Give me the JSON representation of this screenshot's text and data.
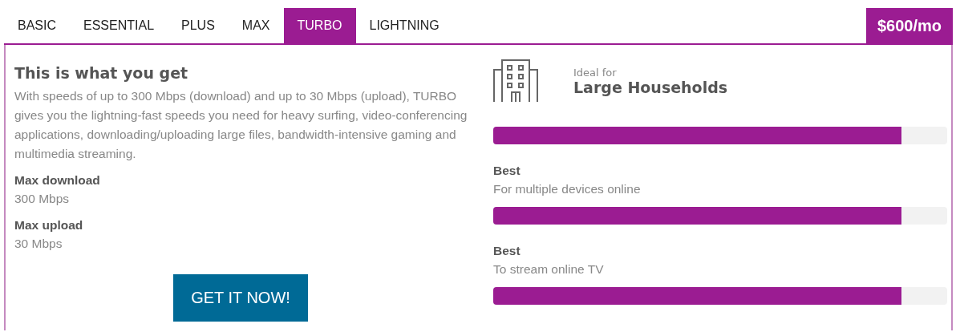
{
  "tabs": [
    {
      "label": "BASIC",
      "selected": false
    },
    {
      "label": "ESSENTIAL",
      "selected": false
    },
    {
      "label": "PLUS",
      "selected": false
    },
    {
      "label": "MAX",
      "selected": false
    },
    {
      "label": "TURBO",
      "selected": true
    },
    {
      "label": "LIGHTNING",
      "selected": false
    }
  ],
  "price": "$600/mo",
  "details": {
    "heading": "This is what you get",
    "description": "With speeds of up to 300 Mbps (download) and up to 30 Mbps (upload), TURBO gives you the lightning-fast speeds you need for heavy surfing, video-conferencing applications, downloading/uploading large files, bandwidth-intensive gaming and multimedia streaming.",
    "specs": [
      {
        "label": "Max download",
        "value": "300 Mbps"
      },
      {
        "label": "Max upload",
        "value": "30 Mbps"
      }
    ],
    "button": "GET IT NOW!"
  },
  "ideal": {
    "label": "Ideal for",
    "value": "Large Households",
    "level": 0.9
  },
  "ratings": [
    {
      "title": "Best",
      "subtitle": "For multiple devices online",
      "level": 0.9
    },
    {
      "title": "Best",
      "subtitle": "To stream online TV",
      "level": 0.9
    }
  ]
}
